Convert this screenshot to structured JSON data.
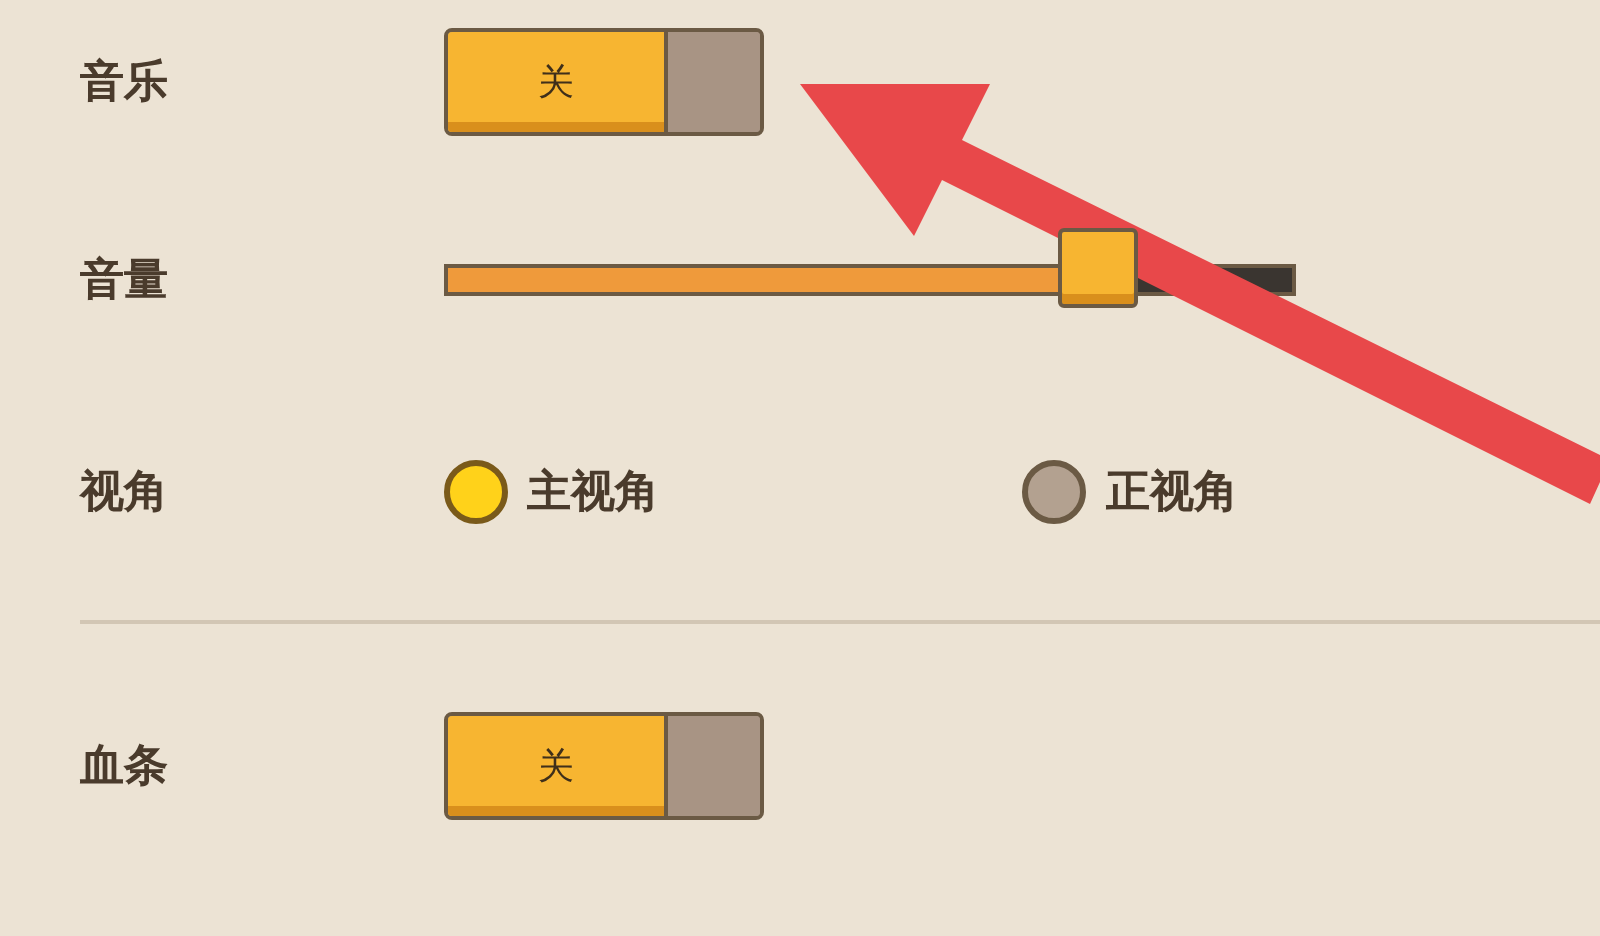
{
  "settings": [
    {
      "kind": "toggle",
      "label": "音乐",
      "on": false,
      "toggle_text": "关"
    },
    {
      "kind": "slider",
      "label": "音量",
      "level": 0.77
    },
    {
      "kind": "radio",
      "label": "视角",
      "options": [
        {
          "label": "主视角",
          "selected": true
        },
        {
          "label": "正视角",
          "selected": false
        }
      ]
    },
    {
      "kind": "divider"
    },
    {
      "kind": "toggle",
      "label": "血条",
      "on": false,
      "toggle_text": "关"
    }
  ]
}
